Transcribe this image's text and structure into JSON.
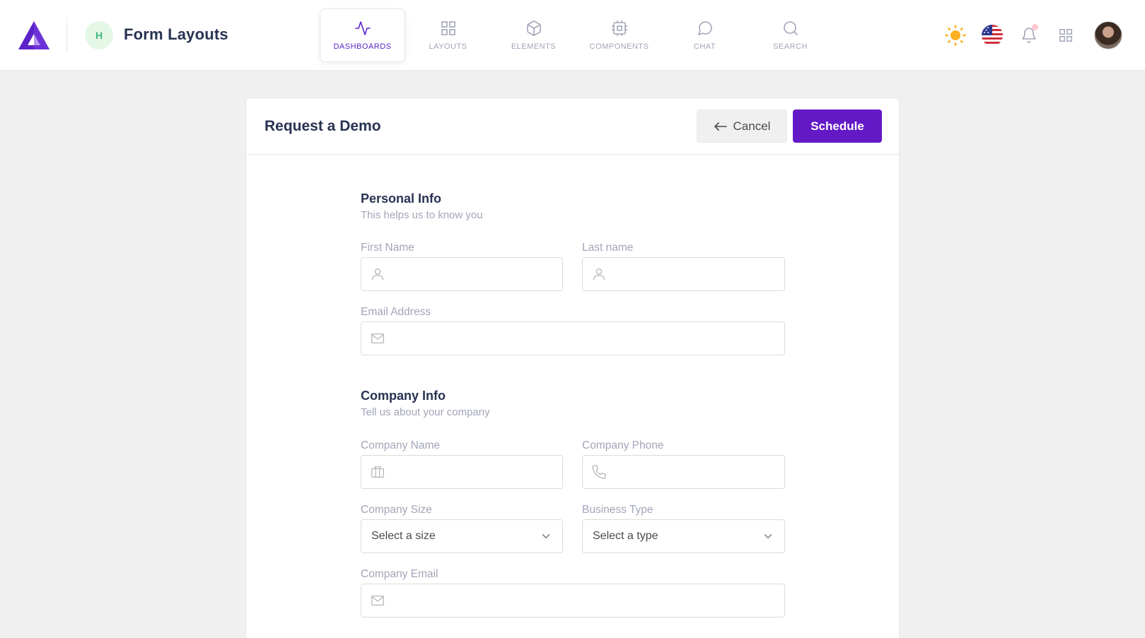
{
  "header": {
    "avatar_initial": "H",
    "title": "Form Layouts",
    "tabs": [
      {
        "label": "DASHBOARDS",
        "icon": "activity-icon",
        "active": true
      },
      {
        "label": "LAYOUTS",
        "icon": "grid-icon",
        "active": false
      },
      {
        "label": "ELEMENTS",
        "icon": "box-icon",
        "active": false
      },
      {
        "label": "COMPONENTS",
        "icon": "cpu-icon",
        "active": false
      },
      {
        "label": "CHAT",
        "icon": "message-circle-icon",
        "active": false
      },
      {
        "label": "SEARCH",
        "icon": "search-icon",
        "active": false
      }
    ],
    "right_icons": [
      "sun-icon",
      "us-flag-icon",
      "bell-icon",
      "apps-grid-icon"
    ]
  },
  "colors": {
    "brand": "#6419c7",
    "muted_text": "#a2a5b9",
    "heading": "#283252",
    "sun": "#ffb020",
    "notification_dot": "#ffc7d1"
  },
  "card": {
    "title": "Request a Demo",
    "cancel_label": "Cancel",
    "schedule_label": "Schedule"
  },
  "personal": {
    "title": "Personal Info",
    "subtitle": "This helps us to know you",
    "first_name_label": "First Name",
    "last_name_label": "Last name",
    "email_label": "Email Address"
  },
  "company": {
    "title": "Company Info",
    "subtitle": "Tell us about your company",
    "name_label": "Company Name",
    "phone_label": "Company Phone",
    "size_label": "Company Size",
    "size_value": "Select a size",
    "type_label": "Business Type",
    "type_value": "Select a type",
    "email_label": "Company Email"
  }
}
